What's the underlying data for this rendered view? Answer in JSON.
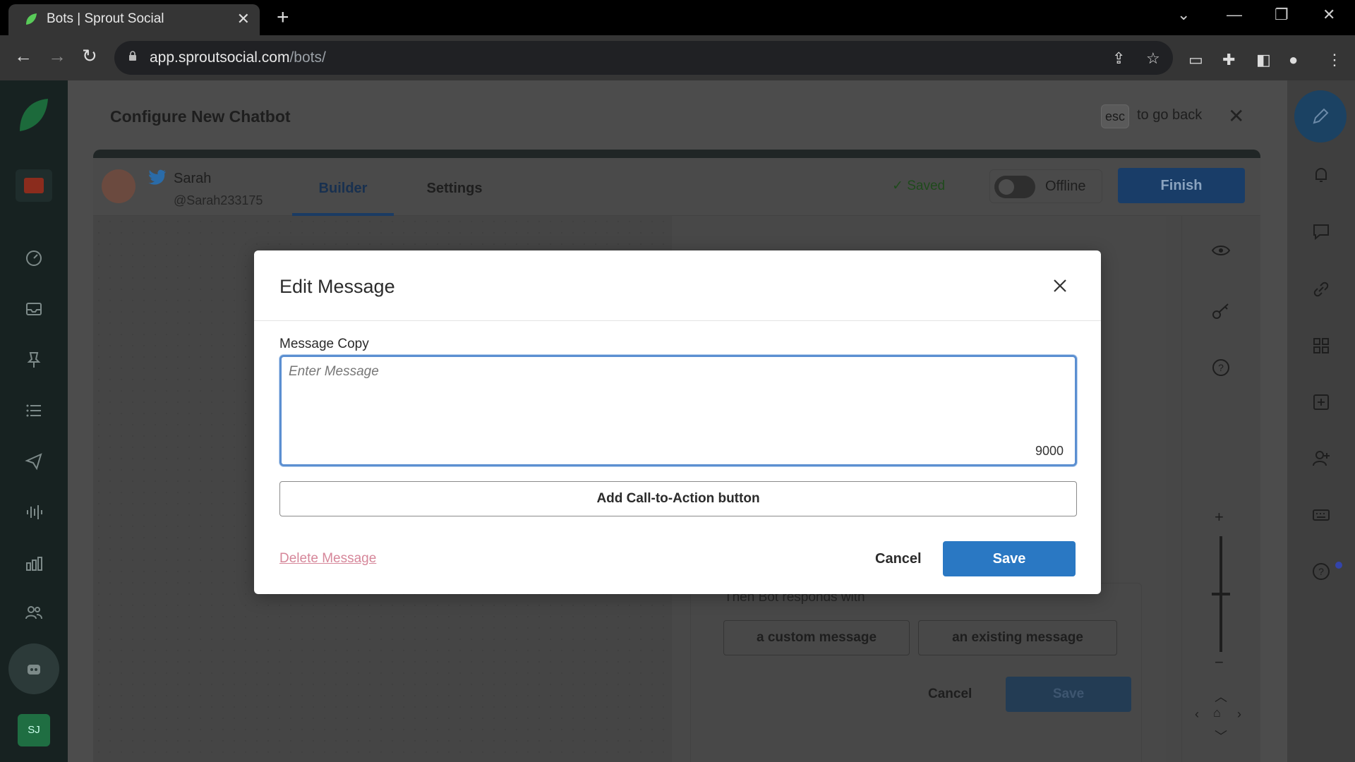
{
  "browser": {
    "tab_title": "Bots | Sprout Social",
    "tab_close": "✕",
    "new_tab": "+",
    "url_host": "app.sproutsocial.com",
    "url_path": "/bots/"
  },
  "page": {
    "title": "Configure New Chatbot",
    "esc_key": "esc",
    "esc_hint": "to go back"
  },
  "builder": {
    "profile_name": "Sarah",
    "profile_handle": "@Sarah233175",
    "tabs": [
      {
        "label": "Builder",
        "active": true
      },
      {
        "label": "Settings",
        "active": false
      }
    ],
    "saved_label": "Saved",
    "status_label": "Offline",
    "finish_label": "Finish"
  },
  "panel": {
    "partial_text": "Then Bot responds with",
    "option_custom": "a custom message",
    "option_existing": "an existing message",
    "cancel_label": "Cancel",
    "save_label": "Save"
  },
  "zoom": {
    "plus": "+",
    "minus": "−"
  },
  "user_initials": "SJ",
  "modal": {
    "title": "Edit Message",
    "field_label": "Message Copy",
    "placeholder": "Enter Message",
    "char_count": "9000",
    "cta_label": "Add Call-to-Action button",
    "delete_label": "Delete Message",
    "cancel_label": "Cancel",
    "save_label": "Save"
  },
  "colors": {
    "primary": "#2a78c3",
    "focus_border": "#5b8fd1",
    "delete_link": "#d6879a",
    "nav_bg": "#172221"
  }
}
